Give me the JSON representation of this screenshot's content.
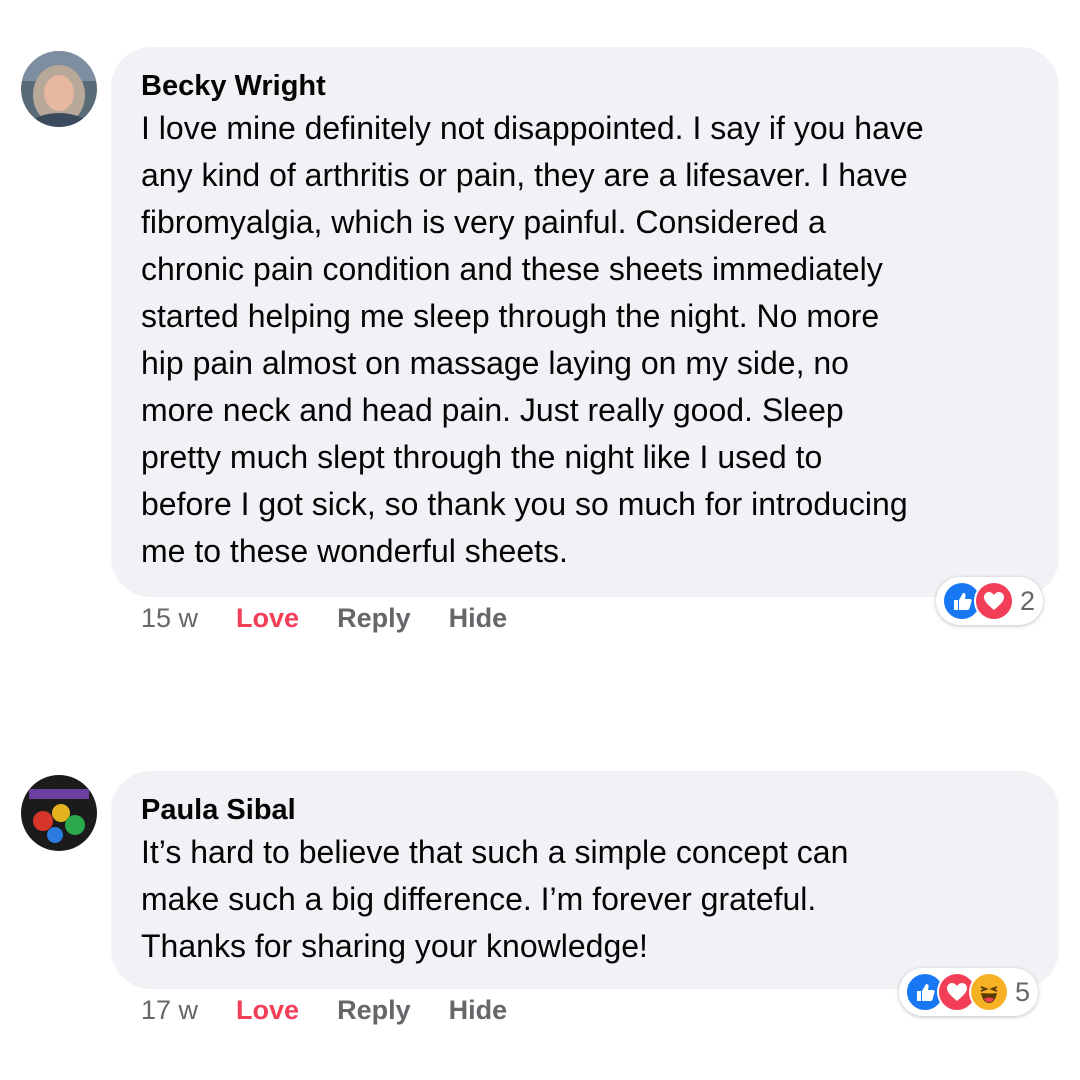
{
  "comments": [
    {
      "author": "Becky Wright",
      "lines": [
        "I love mine definitely not disappointed. I say if you have",
        "any kind of arthritis or pain, they are a lifesaver. I have",
        "fibromyalgia, which is very painful. Considered a",
        "chronic pain condition and these sheets immediately",
        "started helping me sleep through the night. No more",
        "hip pain almost on massage laying on my side, no",
        "more neck and head pain. Just really good. Sleep",
        "pretty much slept through the night like I used to",
        "before I got sick, so thank you so much for introducing",
        "me to these wonderful sheets."
      ],
      "time": "15 w",
      "love_label": "Love",
      "reply_label": "Reply",
      "hide_label": "Hide",
      "reactions": [
        "like-icon",
        "love-icon"
      ],
      "reaction_count": "2"
    },
    {
      "author": "Paula Sibal",
      "lines": [
        "It’s hard to believe that such a simple concept can",
        "make such a big difference. I’m forever grateful.",
        "Thanks for sharing your knowledge!"
      ],
      "time": "17 w",
      "love_label": "Love",
      "reply_label": "Reply",
      "hide_label": "Hide",
      "reactions": [
        "like-icon",
        "love-icon",
        "haha-icon"
      ],
      "reaction_count": "5"
    }
  ],
  "colors": {
    "bubble": "#f0f2f5",
    "love": "#f33e58",
    "muted": "#65676b",
    "like_blue": "#1877f2",
    "haha_yellow": "#f7b125"
  }
}
